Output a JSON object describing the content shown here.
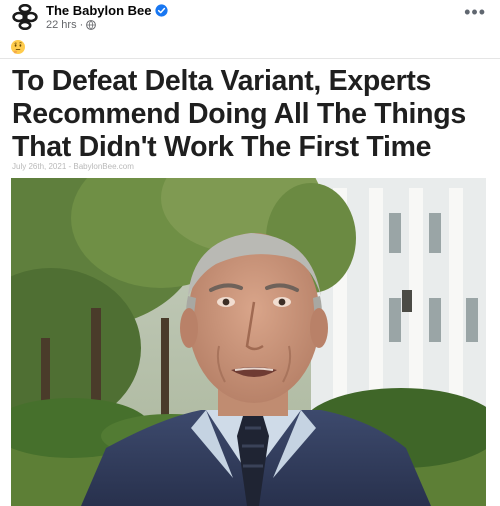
{
  "post": {
    "page_name": "The Babylon Bee",
    "time_ago": "22 hrs",
    "separator": "·",
    "more_glyph": "•••",
    "reaction_emoji": "thinking-face"
  },
  "article": {
    "headline": "To Defeat Delta Variant, Experts Recommend Doing All The Things That Didn't Work The First Time",
    "byline": "July 26th, 2021 - BabylonBee.com"
  },
  "colors": {
    "verified_blue": "#1877f2",
    "bee_yellow": "#f5c518",
    "headline_text": "#1f1f1f",
    "meta_gray": "#65676b"
  },
  "icons": [
    "bee-logo-icon",
    "verified-badge-icon",
    "globe-icon",
    "more-options-icon",
    "thinking-face-emoji"
  ]
}
